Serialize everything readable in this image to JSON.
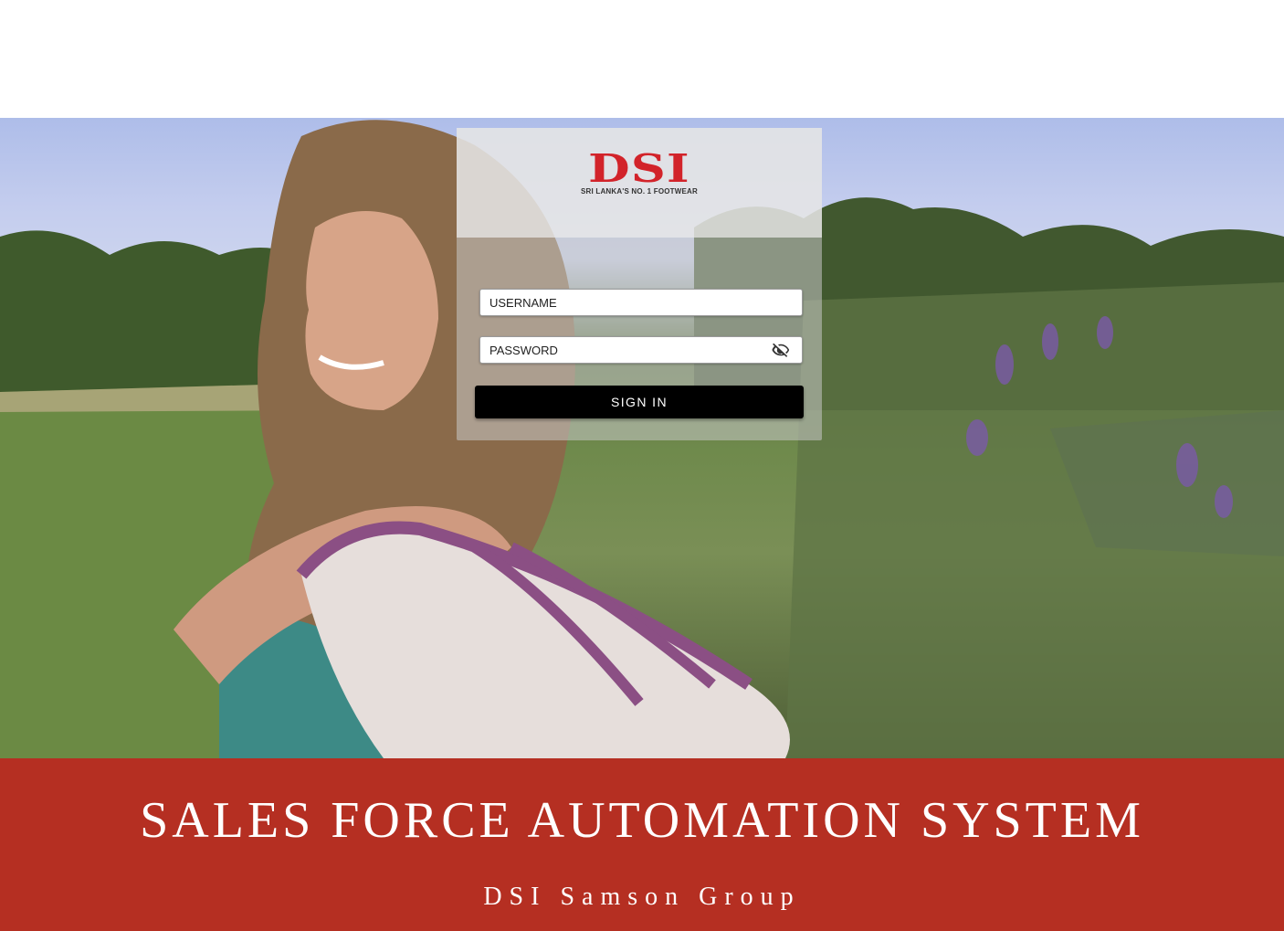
{
  "logo": {
    "brand": "DSI",
    "tagline": "SRI LANKA'S NO. 1 FOOTWEAR"
  },
  "login": {
    "username_placeholder": "USERNAME",
    "password_placeholder": "PASSWORD",
    "password_visibility_icon": "eye-off-icon",
    "signin_label": "SIGN IN"
  },
  "footer": {
    "title": "SALES FORCE AUTOMATION SYSTEM",
    "subtitle": "DSI Samson Group"
  },
  "colors": {
    "brand_red": "#d2232a",
    "footer_background": "#b52f22",
    "button_background": "#000000"
  }
}
